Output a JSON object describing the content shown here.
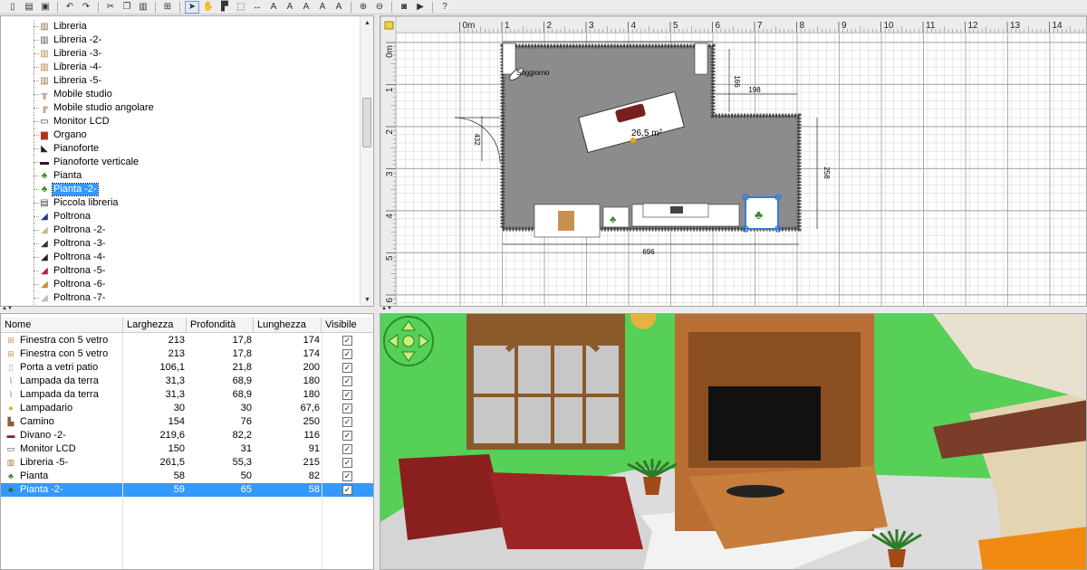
{
  "toolbar": {
    "icons": [
      "new-file-icon",
      "open-file-icon",
      "save-icon",
      "undo-icon",
      "redo-icon",
      "cut-icon",
      "copy-icon",
      "paste-icon",
      "add-furniture-icon",
      "select-arrow-icon",
      "pan-hand-icon",
      "create-walls-icon",
      "create-rooms-icon",
      "create-dimensions-icon",
      "add-text-icon",
      "text-style-icon",
      "text-bold-icon",
      "text-italic-icon",
      "text-size-icon",
      "zoom-in-icon",
      "zoom-out-icon",
      "photo-icon",
      "video-icon",
      "help-icon"
    ]
  },
  "tree": {
    "items": [
      {
        "label": "Libreria",
        "icon": "bookcase-icon",
        "color": "#8a6a3e"
      },
      {
        "label": "Libreria -2-",
        "icon": "bookcase-icon",
        "color": "#555555"
      },
      {
        "label": "Libreria -3-",
        "icon": "bookcase-icon",
        "color": "#b88a50"
      },
      {
        "label": "Libreria -4-",
        "icon": "bookcase-icon",
        "color": "#b07a40"
      },
      {
        "label": "Libreria -5-",
        "icon": "bookcase-icon",
        "color": "#a0703a"
      },
      {
        "label": "Mobile studio",
        "icon": "desk-icon",
        "color": "#7a5530"
      },
      {
        "label": "Mobile studio angolare",
        "icon": "corner-desk-icon",
        "color": "#7a5530"
      },
      {
        "label": "Monitor LCD",
        "icon": "monitor-icon",
        "color": "#333333"
      },
      {
        "label": "Organo",
        "icon": "organ-icon",
        "color": "#b03020"
      },
      {
        "label": "Pianoforte",
        "icon": "piano-icon",
        "color": "#222222"
      },
      {
        "label": "Pianoforte verticale",
        "icon": "upright-piano-icon",
        "color": "#222222"
      },
      {
        "label": "Pianta",
        "icon": "plant-icon",
        "color": "#3b8a2a"
      },
      {
        "label": "Pianta -2-",
        "icon": "plant-icon",
        "color": "#3b8a2a"
      },
      {
        "label": "Piccola libreria",
        "icon": "small-bookcase-icon",
        "color": "#444444"
      },
      {
        "label": "Poltrona",
        "icon": "armchair-icon",
        "color": "#1e3a8a"
      },
      {
        "label": "Poltrona -2-",
        "icon": "armchair-icon",
        "color": "#c8b890"
      },
      {
        "label": "Poltrona -3-",
        "icon": "armchair-icon",
        "color": "#333333"
      },
      {
        "label": "Poltrona -4-",
        "icon": "armchair-icon",
        "color": "#222222"
      },
      {
        "label": "Poltrona -5-",
        "icon": "armchair-icon",
        "color": "#b02040"
      },
      {
        "label": "Poltrona -6-",
        "icon": "armchair-icon",
        "color": "#c09020"
      },
      {
        "label": "Poltrona -7-",
        "icon": "armchair-icon",
        "color": "#bbbbbb"
      }
    ],
    "selected_index": 12
  },
  "table": {
    "columns": [
      "Nome",
      "Larghezza",
      "Profondità",
      "Lunghezza",
      "Visibile"
    ],
    "rows": [
      {
        "name": "Finestra con 5 vetro",
        "icon": "window-icon",
        "w": "213",
        "d": "17,8",
        "h": "174",
        "visible": true
      },
      {
        "name": "Finestra con 5 vetro",
        "icon": "window-icon",
        "w": "213",
        "d": "17,8",
        "h": "174",
        "visible": true
      },
      {
        "name": "Porta a vetri patio",
        "icon": "patio-door-icon",
        "w": "106,1",
        "d": "21,8",
        "h": "200",
        "visible": true
      },
      {
        "name": "Lampada da terra",
        "icon": "floor-lamp-icon",
        "w": "31,3",
        "d": "68,9",
        "h": "180",
        "visible": true
      },
      {
        "name": "Lampada da terra",
        "icon": "floor-lamp-icon",
        "w": "31,3",
        "d": "68,9",
        "h": "180",
        "visible": true
      },
      {
        "name": "Lampadario",
        "icon": "chandelier-icon",
        "w": "30",
        "d": "30",
        "h": "67,6",
        "visible": true
      },
      {
        "name": "Camino",
        "icon": "fireplace-icon",
        "w": "154",
        "d": "76",
        "h": "250",
        "visible": true
      },
      {
        "name": "Divano -2-",
        "icon": "sofa-icon",
        "w": "219,6",
        "d": "82,2",
        "h": "116",
        "visible": true
      },
      {
        "name": "Monitor LCD",
        "icon": "monitor-icon",
        "w": "150",
        "d": "31",
        "h": "91",
        "visible": true
      },
      {
        "name": "Libreria -5-",
        "icon": "bookcase-icon",
        "w": "261,5",
        "d": "55,3",
        "h": "215",
        "visible": true
      },
      {
        "name": "Pianta",
        "icon": "plant-icon",
        "w": "58",
        "d": "50",
        "h": "82",
        "visible": true
      },
      {
        "name": "Pianta -2-",
        "icon": "plant-icon",
        "w": "59",
        "d": "65",
        "h": "58",
        "visible": true
      }
    ],
    "selected_index": 11,
    "check_mark": "✓"
  },
  "plan": {
    "h_ruler": [
      "0m",
      "1",
      "2",
      "3",
      "4",
      "5",
      "6",
      "7",
      "8",
      "9",
      "10",
      "11",
      "12",
      "13",
      "14"
    ],
    "v_ruler": [
      "0m",
      "1",
      "2",
      "3",
      "4",
      "5",
      "6"
    ],
    "room_label": "Soggiorno",
    "room_area": "26,5 m²",
    "dimensions": {
      "top_right": "198",
      "right_notch": "166",
      "left": "432",
      "right": "258",
      "bottom": "696"
    },
    "colors": {
      "room_fill": "#8c8c8c",
      "wall": "#555555",
      "grid": "#d8d8d8",
      "selection": "#3a7bd5"
    }
  },
  "view3d": {
    "colors": {
      "wall_green": "#56d056",
      "floor": "#e8e8e8",
      "wood": "#b96e34",
      "sofa": "#8a1f1f",
      "tv": "#111111",
      "fireplace": "#e3d4b2",
      "window_frame": "#8b5a2b",
      "window_glass": "#c7c7c7"
    }
  }
}
